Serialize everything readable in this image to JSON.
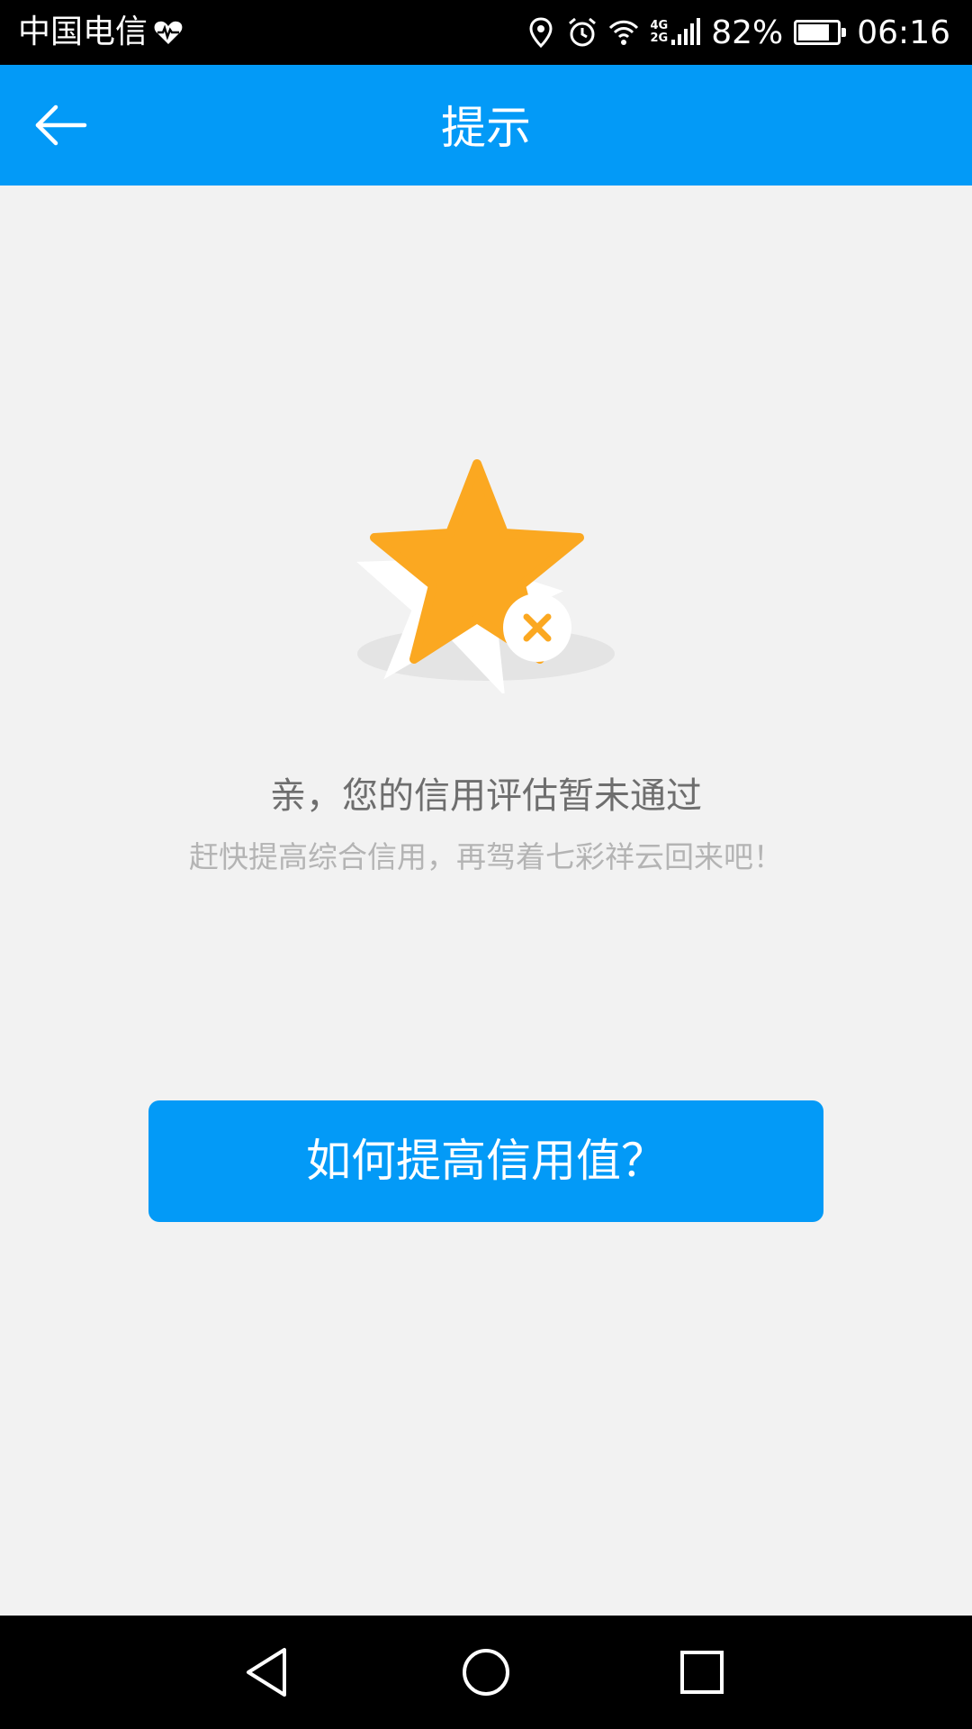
{
  "status_bar": {
    "carrier": "中国电信",
    "network_top": "4G",
    "network_bottom": "2G",
    "battery_percent": "82%",
    "battery_level": 0.82,
    "time": "06:16",
    "icons": [
      "heart-health-icon",
      "location-icon",
      "alarm-icon",
      "wifi-icon",
      "signal-icon",
      "battery-icon"
    ]
  },
  "app_bar": {
    "title": "提示",
    "back_icon": "arrow-back-icon",
    "background": "#039af7"
  },
  "illustration": {
    "icon": "star-rejected-icon",
    "star_color": "#fba821",
    "badge_icon": "close-icon"
  },
  "message": {
    "main": "亲，您的信用评估暂未通过",
    "sub": "赶快提高综合信用，再驾着七彩祥云回来吧！"
  },
  "action": {
    "button_label": "如何提高信用值？",
    "color": "#039af7"
  },
  "nav_bar": {
    "icons": [
      "nav-back-icon",
      "nav-home-icon",
      "nav-recent-icon"
    ]
  }
}
